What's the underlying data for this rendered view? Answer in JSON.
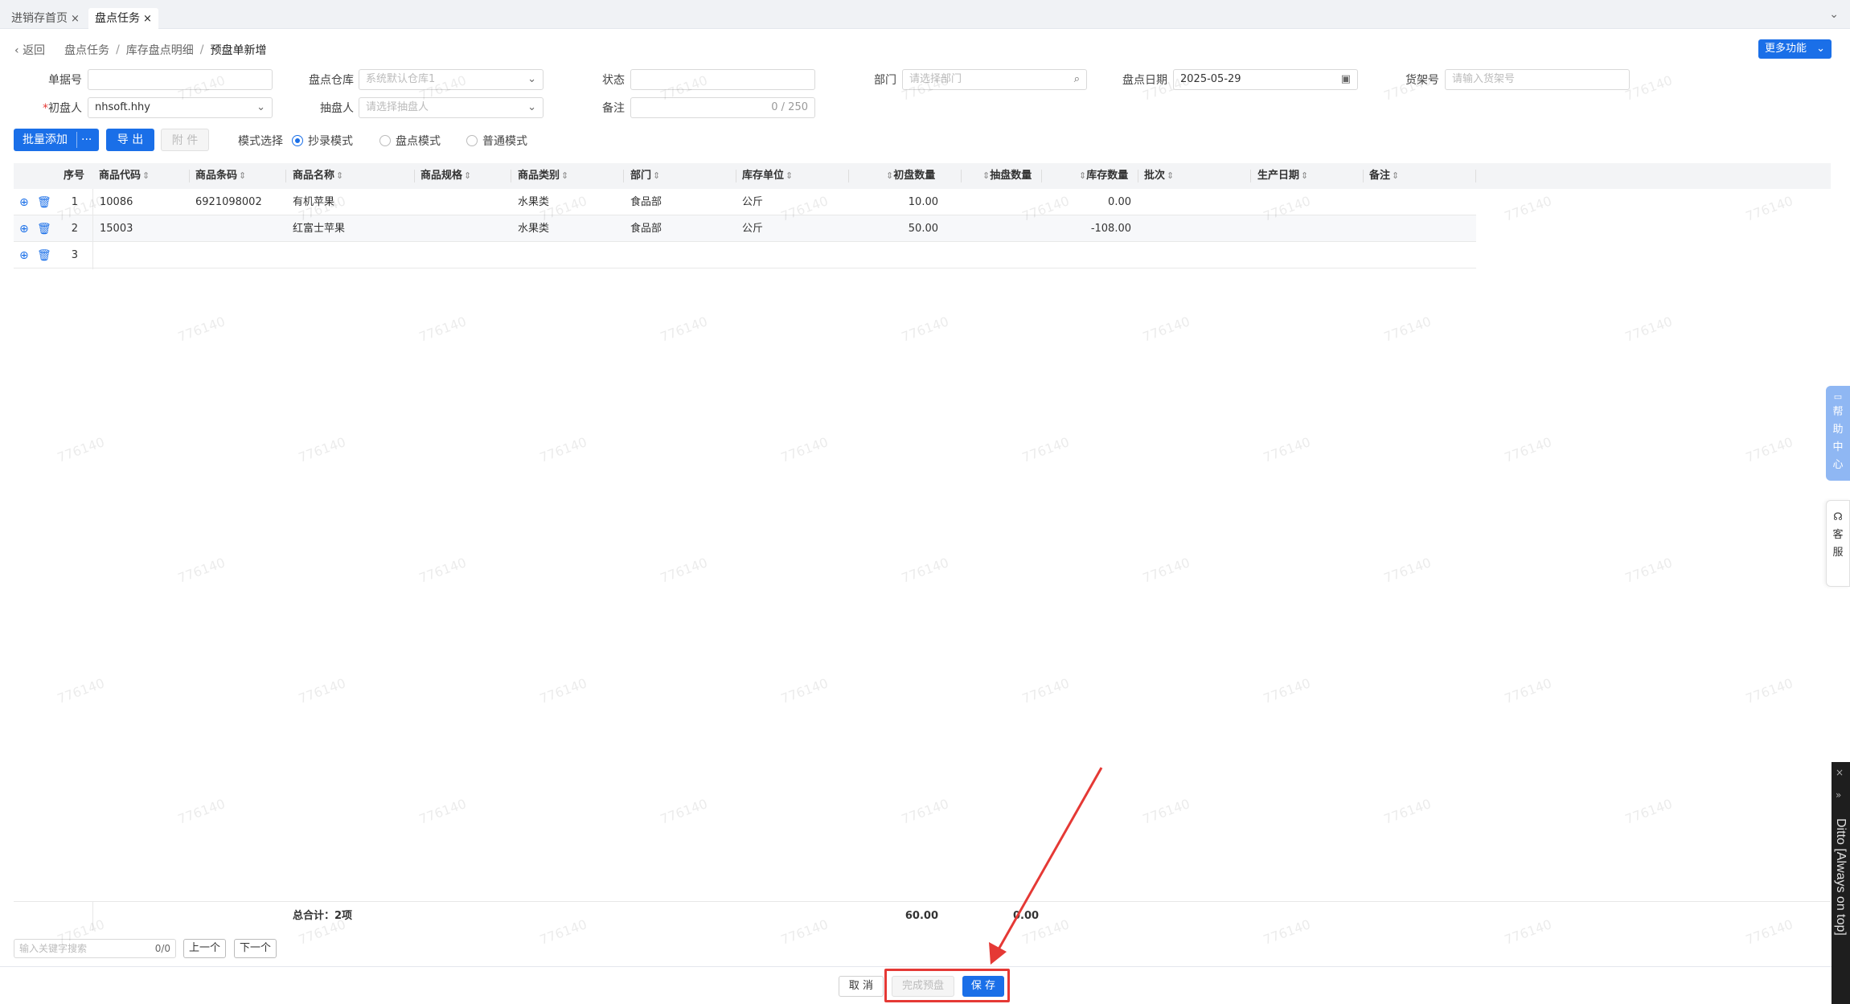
{
  "tabs": [
    {
      "label": "进销存首页",
      "close": "×"
    },
    {
      "label": "盘点任务",
      "close": "×"
    }
  ],
  "tab_dropdown": "⌄",
  "breadcrumb": {
    "back": "返回",
    "items": [
      "盘点任务",
      "库存盘点明细",
      "预盘单新增"
    ],
    "sep": "/"
  },
  "more_button": "更多功能",
  "form": {
    "doc_no": {
      "label": "单据号",
      "value": ""
    },
    "warehouse": {
      "label": "盘点仓库",
      "placeholder": "系统默认仓库1"
    },
    "status": {
      "label": "状态",
      "value": ""
    },
    "department": {
      "label": "部门",
      "placeholder": "请选择部门"
    },
    "date": {
      "label": "盘点日期",
      "value": "2025-05-29"
    },
    "shelf": {
      "label": "货架号",
      "placeholder": "请输入货架号"
    },
    "first_counter": {
      "label": "初盘人",
      "required": "*",
      "value": "nhsoft.hhy"
    },
    "sample_counter": {
      "label": "抽盘人",
      "placeholder": "请选择抽盘人"
    },
    "remark": {
      "label": "备注",
      "counter": "0 / 250"
    }
  },
  "toolbar": {
    "batch_add": "批量添加",
    "more": "···",
    "export": "导 出",
    "attachment": "附 件",
    "mode_label": "模式选择",
    "modes": [
      {
        "label": "抄录模式",
        "selected": true
      },
      {
        "label": "盘点模式",
        "selected": false
      },
      {
        "label": "普通模式",
        "selected": false
      }
    ]
  },
  "table": {
    "headers": {
      "seq": "序号",
      "code": "商品代码",
      "barcode": "商品条码",
      "name": "商品名称",
      "spec": "商品规格",
      "category": "商品类别",
      "dept": "部门",
      "unit": "库存单位",
      "first_qty": "初盘数量",
      "sample_qty": "抽盘数量",
      "stock_qty": "库存数量",
      "batch": "批次",
      "prod_date": "生产日期",
      "remark": "备注"
    },
    "sort_glyph": "⇕",
    "rows": [
      {
        "seq": "1",
        "code": "10086",
        "barcode": "6921098002",
        "name": "有机苹果",
        "category": "水果类",
        "dept": "食品部",
        "unit": "公斤",
        "first_qty": "10.00",
        "stock_qty": "0.00"
      },
      {
        "seq": "2",
        "code": "15003",
        "barcode": "",
        "name": "红富士苹果",
        "category": "水果类",
        "dept": "食品部",
        "unit": "公斤",
        "first_qty": "50.00",
        "stock_qty": "-108.00"
      },
      {
        "seq": "3",
        "code": "",
        "barcode": "",
        "name": "",
        "category": "",
        "dept": "",
        "unit": "",
        "first_qty": "",
        "stock_qty": ""
      }
    ]
  },
  "summary": {
    "total_label": "总合计：2项",
    "first_qty_total": "60.00",
    "sample_qty_total": "0.00"
  },
  "search": {
    "placeholder": "输入关键字搜索",
    "count": "0/0",
    "prev": "上一个",
    "next": "下一个"
  },
  "footer": {
    "cancel": "取 消",
    "finish": "完成预盘",
    "save": "保 存"
  },
  "watermark": "776140",
  "side": {
    "help": [
      "帮",
      "助",
      "中",
      "心"
    ],
    "service": [
      "客",
      "服"
    ]
  },
  "ditto": {
    "title": "Ditto [Always on top]",
    "close": "×",
    "pin": "»"
  },
  "colors": {
    "primary": "#1a6fe8",
    "highlight": "#e53935"
  }
}
